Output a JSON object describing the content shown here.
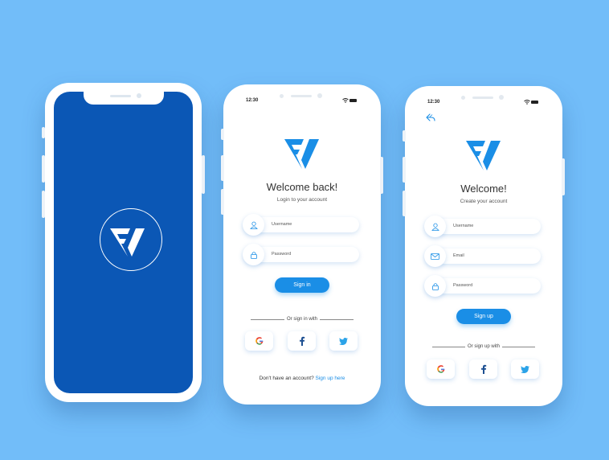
{
  "colors": {
    "background": "#72bdf9",
    "splash": "#0b57b5",
    "accent": "#1a8ee6",
    "logo": "#1a8ee6"
  },
  "login": {
    "time": "12:30",
    "title": "Welcome back!",
    "subtitle": "Login to your account",
    "username_placeholder": "Username",
    "password_placeholder": "Password",
    "signin_label": "Sign in",
    "divider_text": "Or sign in with",
    "footer_text": "Don't have an account?",
    "footer_link": "Sign up here",
    "icons": [
      "user-icon",
      "lock-icon",
      "google-icon",
      "facebook-icon",
      "twitter-icon"
    ]
  },
  "signup": {
    "time": "12:30",
    "title": "Welcome!",
    "subtitle": "Create your account",
    "username_placeholder": "Username",
    "email_placeholder": "Email",
    "password_placeholder": "Password",
    "signup_label": "Sign up",
    "divider_text": "Or sign up with",
    "icons": [
      "back-icon",
      "user-icon",
      "mail-icon",
      "lock-icon",
      "google-icon",
      "facebook-icon",
      "twitter-icon"
    ]
  }
}
